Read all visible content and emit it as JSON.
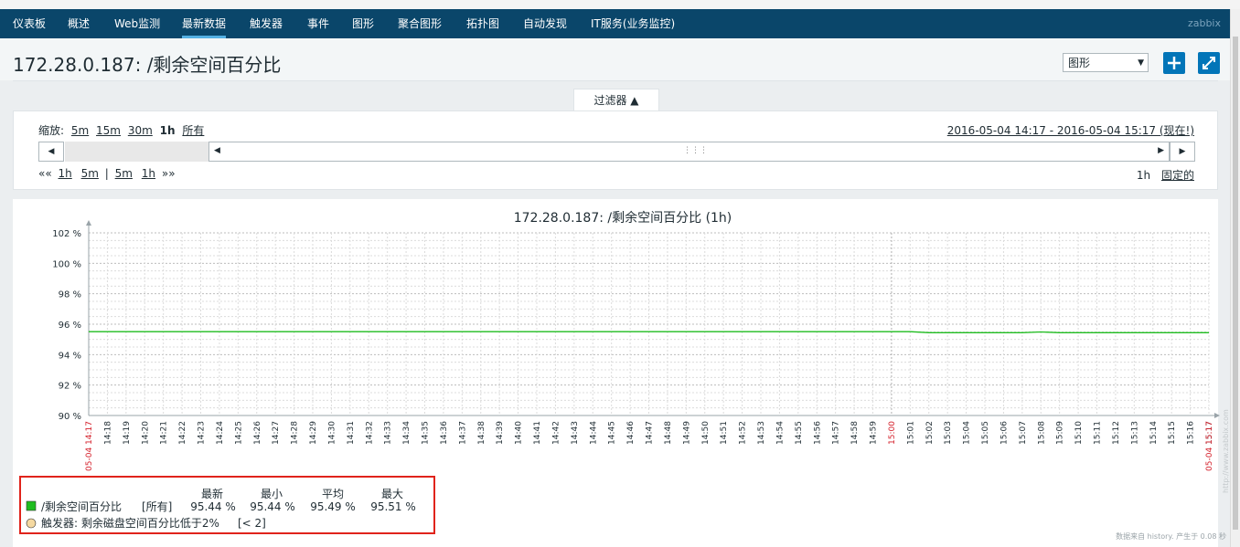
{
  "nav": {
    "items": [
      "仪表板",
      "概述",
      "Web监测",
      "最新数据",
      "触发器",
      "事件",
      "图形",
      "聚合图形",
      "拓扑图",
      "自动发现",
      "IT服务(业务监控)"
    ],
    "active_index": 3,
    "brand": "zabbix"
  },
  "page": {
    "title": "172.28.0.187: /剩余空间百分比",
    "view_select": "图形",
    "add_icon": "plus-icon",
    "fullscreen_icon": "fullscreen-icon"
  },
  "filter": {
    "tab_label": "过滤器 ▲",
    "zoom_label": "缩放:",
    "zoom_options": [
      "5m",
      "15m",
      "30m",
      "1h",
      "所有"
    ],
    "zoom_selected": "1h",
    "period_text": "2016-05-04 14:17 - 2016-05-04 15:17 (现在!)",
    "back_label": "««",
    "nav_links": [
      "1h",
      "5m",
      "|",
      "5m",
      "1h"
    ],
    "fwd_label": "»»",
    "duration": "1h",
    "fixed_label": "固定的",
    "left_arrow": "◀",
    "right_arrow": "▶",
    "grip": "⋮⋮⋮"
  },
  "chart_data": {
    "type": "line",
    "title": "172.28.0.187: /剩余空间百分比 (1h)",
    "ylim": [
      90,
      102
    ],
    "y_ticks": [
      "102 %",
      "100 %",
      "98 %",
      "96 %",
      "94 %",
      "92 %",
      "90 %"
    ],
    "x_start_label": "05-04 14:17",
    "x_end_label": "05-04 15:17",
    "x_ticks": [
      "14:18",
      "14:19",
      "14:20",
      "14:21",
      "14:22",
      "14:23",
      "14:24",
      "14:25",
      "14:26",
      "14:27",
      "14:28",
      "14:29",
      "14:30",
      "14:31",
      "14:32",
      "14:33",
      "14:34",
      "14:35",
      "14:36",
      "14:37",
      "14:38",
      "14:39",
      "14:40",
      "14:41",
      "14:42",
      "14:43",
      "14:44",
      "14:45",
      "14:46",
      "14:47",
      "14:48",
      "14:49",
      "14:50",
      "14:51",
      "14:52",
      "14:53",
      "14:54",
      "14:55",
      "14:56",
      "14:57",
      "14:58",
      "14:59",
      "15:00",
      "15:01",
      "15:02",
      "15:03",
      "15:04",
      "15:05",
      "15:06",
      "15:07",
      "15:08",
      "15:09",
      "15:10",
      "15:11",
      "15:12",
      "15:13",
      "15:14",
      "15:15",
      "15:16",
      "15:17"
    ],
    "highlight_tick": "15:00",
    "series": [
      {
        "name": "/剩余空间百分比",
        "color": "#1fbd1f",
        "x": [
          0,
          10,
          20,
          30,
          40,
          44,
          45,
          50,
          51,
          52,
          53,
          60
        ],
        "y": [
          95.51,
          95.51,
          95.51,
          95.51,
          95.51,
          95.51,
          95.44,
          95.44,
          95.49,
          95.44,
          95.44,
          95.44
        ]
      }
    ],
    "watermark": "http://www.zabbix.com"
  },
  "legend": {
    "headers": [
      "最新",
      "最小",
      "平均",
      "最大"
    ],
    "item_name": "/剩余空间百分比",
    "item_tag": "[所有]",
    "values": [
      "95.44 %",
      "95.44 %",
      "95.49 %",
      "95.51 %"
    ],
    "trigger_label": "触发器: 剩余磁盘空间百分比低于2%",
    "trigger_cond": "[< 2]",
    "trigger_color": "#f5d9a1"
  },
  "footer": {
    "note": "数据来自 history. 产生于 0.08 秒"
  }
}
